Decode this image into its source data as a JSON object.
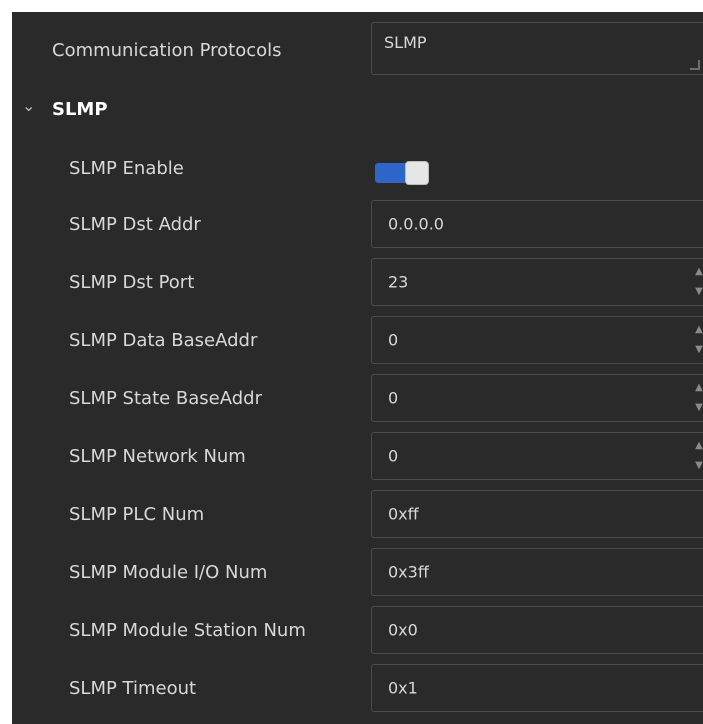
{
  "protocol": {
    "label": "Communication Protocols",
    "value": "SLMP"
  },
  "section": {
    "title": "SLMP",
    "chevron_icon": "chevron-down-icon"
  },
  "enable": {
    "label": "SLMP Enable",
    "on": true,
    "accent": "#2e67c9"
  },
  "rows": [
    {
      "label": "SLMP Dst Addr",
      "value": "0.0.0.0",
      "spinner": false
    },
    {
      "label": "SLMP Dst Port",
      "value": "23",
      "spinner": true
    },
    {
      "label": "SLMP Data BaseAddr",
      "value": "0",
      "spinner": true
    },
    {
      "label": "SLMP State BaseAddr",
      "value": "0",
      "spinner": true
    },
    {
      "label": "SLMP Network Num",
      "value": "0",
      "spinner": true
    },
    {
      "label": "SLMP PLC Num",
      "value": "0xff",
      "spinner": false
    },
    {
      "label": "SLMP Module I/O Num",
      "value": "0x3ff",
      "spinner": false
    },
    {
      "label": "SLMP Module Station Num",
      "value": "0x0",
      "spinner": false
    },
    {
      "label": "SLMP Timeout",
      "value": "0x1",
      "spinner": false
    }
  ]
}
